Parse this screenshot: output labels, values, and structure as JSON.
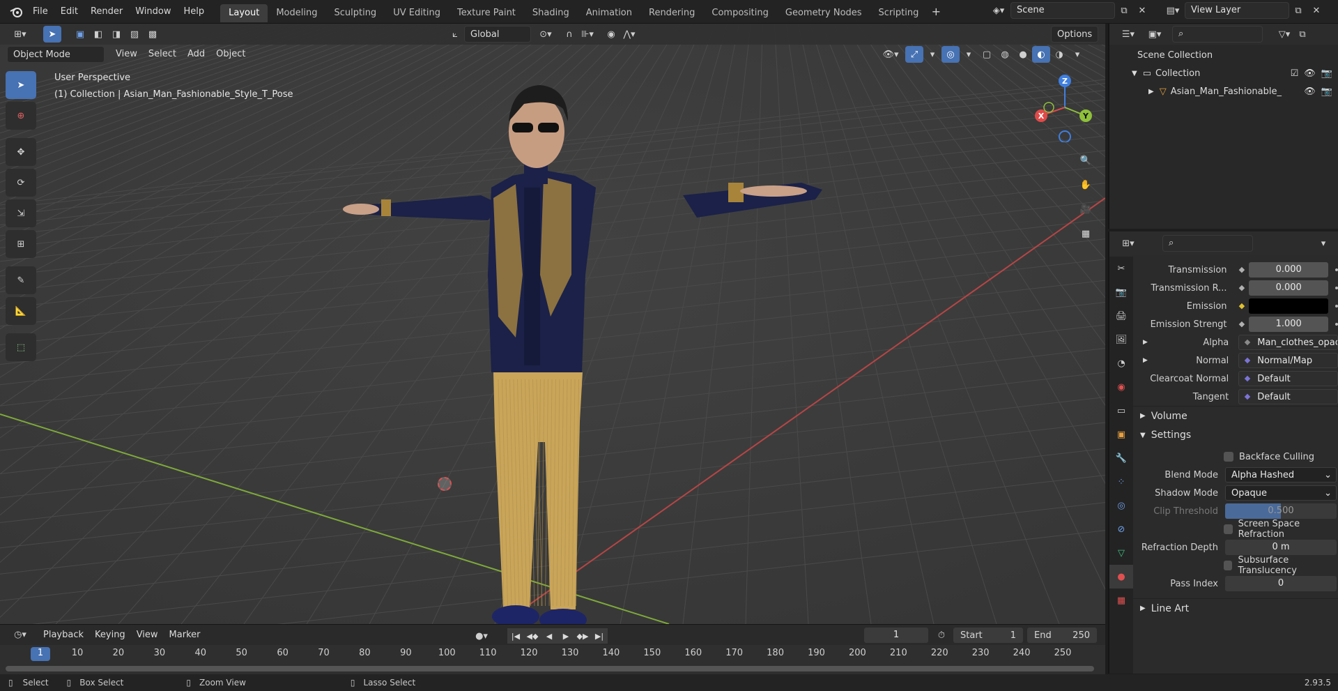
{
  "topbar": {
    "menus": [
      "File",
      "Edit",
      "Render",
      "Window",
      "Help"
    ],
    "workspaces": [
      "Layout",
      "Modeling",
      "Sculpting",
      "UV Editing",
      "Texture Paint",
      "Shading",
      "Animation",
      "Rendering",
      "Compositing",
      "Geometry Nodes",
      "Scripting"
    ],
    "active_workspace": "Layout",
    "scene": "Scene",
    "view_layer": "View Layer"
  },
  "viewport_header": {
    "mode": "Object Mode",
    "menus": [
      "View",
      "Select",
      "Add",
      "Object"
    ],
    "transform_orientation": "Global",
    "options": "Options"
  },
  "viewport": {
    "perspective": "User Perspective",
    "collection_info": "(1) Collection | Asian_Man_Fashionable_Style_T_Pose",
    "gizmo_axes": {
      "z": "Z",
      "x": "X",
      "y": "Y"
    },
    "colors": {
      "x_axis": "#e04a4a",
      "y_axis": "#8ec03a",
      "z_axis": "#3f7fe0",
      "accent": "#4772b3"
    }
  },
  "outliner": {
    "root": "Scene Collection",
    "collection": "Collection",
    "object": "Asian_Man_Fashionable_"
  },
  "properties": {
    "rows": [
      {
        "label": "Transmission",
        "value": "0.000"
      },
      {
        "label": "Transmission R...",
        "value": "0.000"
      },
      {
        "label": "Emission",
        "value": ""
      },
      {
        "label": "Emission Strengt",
        "value": "1.000"
      },
      {
        "label": "Alpha",
        "value": "Man_clothes_opacit..."
      },
      {
        "label": "Normal",
        "value": "Normal/Map"
      },
      {
        "label": "Clearcoat Normal",
        "value": "Default"
      },
      {
        "label": "Tangent",
        "value": "Default"
      }
    ],
    "section_volume": "Volume",
    "section_settings": "Settings",
    "backface_culling": "Backface Culling",
    "blend_mode_label": "Blend Mode",
    "blend_mode": "Alpha Hashed",
    "shadow_mode_label": "Shadow Mode",
    "shadow_mode": "Opaque",
    "clip_threshold_label": "Clip Threshold",
    "clip_threshold": "0.500",
    "screen_space_refraction": "Screen Space Refraction",
    "refraction_depth_label": "Refraction Depth",
    "refraction_depth": "0 m",
    "subsurface_translucency": "Subsurface Translucency",
    "pass_index_label": "Pass Index",
    "pass_index": "0",
    "section_line_art": "Line Art"
  },
  "timeline": {
    "menus": [
      "Playback",
      "Keying",
      "View",
      "Marker"
    ],
    "current_frame": "1",
    "start_label": "Start",
    "start": "1",
    "end_label": "End",
    "end": "250",
    "ticks": [
      "1",
      "10",
      "20",
      "30",
      "40",
      "50",
      "60",
      "70",
      "80",
      "90",
      "100",
      "110",
      "120",
      "130",
      "140",
      "150",
      "160",
      "170",
      "180",
      "190",
      "200",
      "210",
      "220",
      "230",
      "240",
      "250"
    ]
  },
  "statusbar": {
    "select": "Select",
    "box_select": "Box Select",
    "zoom_view": "Zoom View",
    "lasso_select": "Lasso Select",
    "version": "2.93.5"
  }
}
